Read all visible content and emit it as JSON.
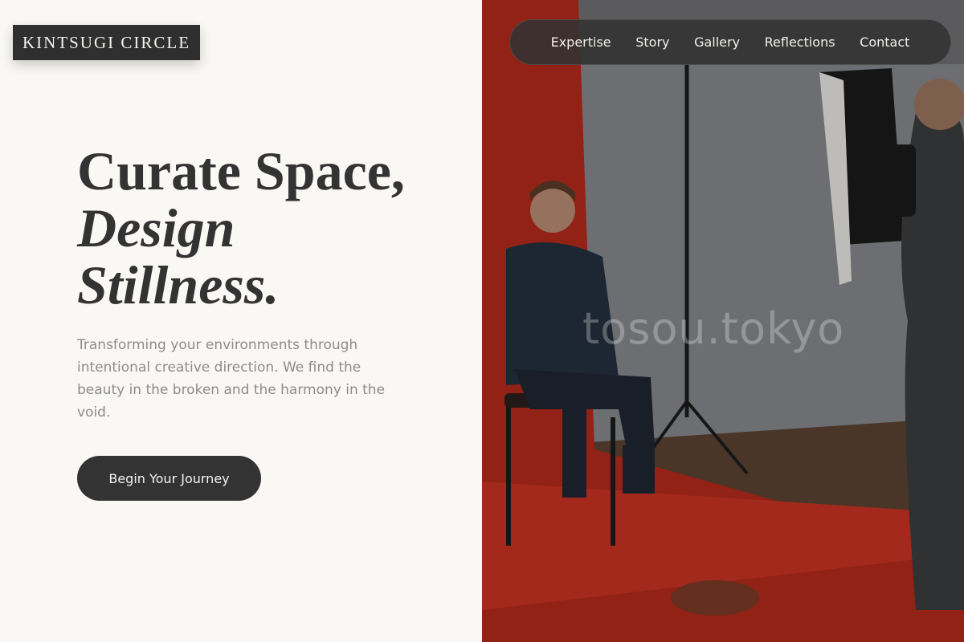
{
  "brand": {
    "logo_text": "KINTSUGI CIRCLE"
  },
  "nav": {
    "items": [
      {
        "label": "Expertise"
      },
      {
        "label": "Story"
      },
      {
        "label": "Gallery"
      },
      {
        "label": "Reflections"
      },
      {
        "label": "Contact"
      }
    ]
  },
  "hero": {
    "headline_line1": "Curate Space,",
    "headline_line2": "Design",
    "headline_line3": "Stillness.",
    "subtitle": "Transforming your environments through intentional creative direction. We find the beauty in the broken and the harmony in the void.",
    "cta_label": "Begin Your Journey"
  },
  "photo": {
    "description_icon": "studio-photo",
    "watermark": "tosou.tokyo"
  },
  "colors": {
    "background": "#f9f8f5",
    "dark": "#333333",
    "muted_text": "#8c8c8c",
    "backdrop_red": "#c0301f"
  }
}
